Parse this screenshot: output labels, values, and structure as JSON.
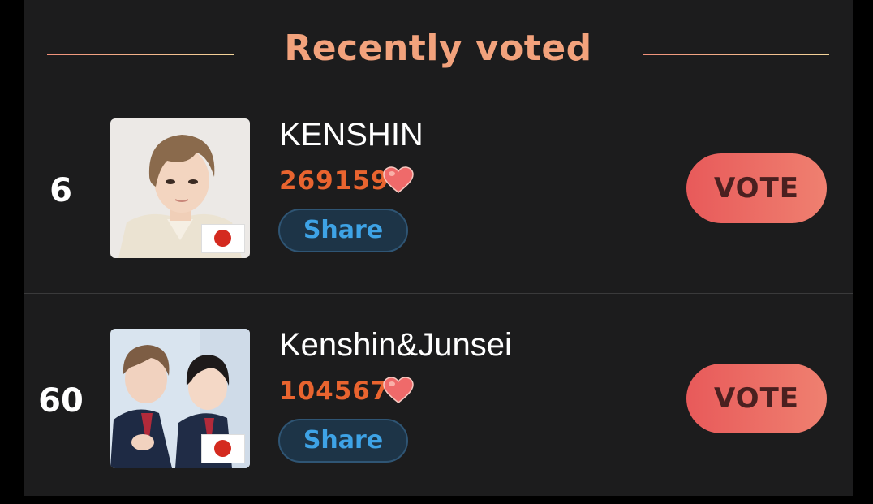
{
  "header": {
    "title": "Recently voted",
    "accent_color": "#f2a27c"
  },
  "entries": [
    {
      "rank": "6",
      "name": "KENSHIN",
      "votes": "269159",
      "share_label": "Share",
      "vote_label": "VOTE",
      "flag": "japan-flag-icon"
    },
    {
      "rank": "60",
      "name": "Kenshin&Junsei",
      "votes": "104567",
      "share_label": "Share",
      "vote_label": "VOTE",
      "flag": "japan-flag-icon"
    }
  ],
  "colors": {
    "background": "#1c1c1d",
    "vote_count": "#e9642f",
    "share_text": "#3ea3e6",
    "vote_button": "#e85a5a"
  }
}
